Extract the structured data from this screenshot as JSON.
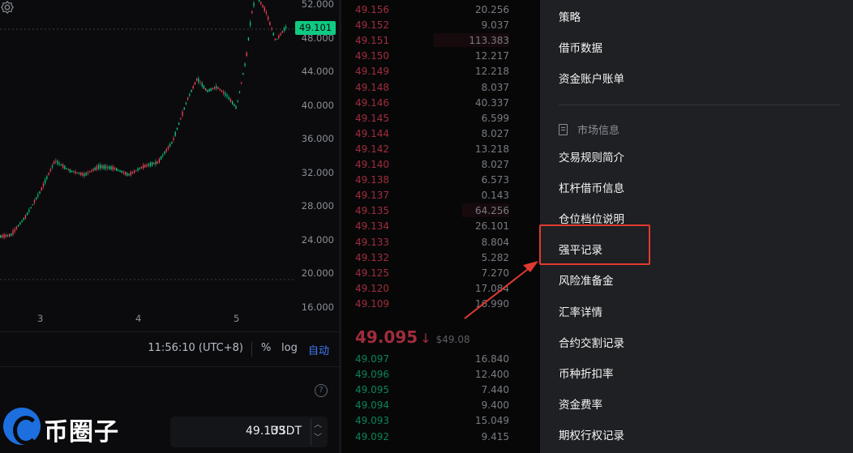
{
  "chart": {
    "y_axis": [
      "52.000",
      "48.000",
      "44.000",
      "40.000",
      "36.000",
      "32.000",
      "28.000",
      "24.000",
      "20.000",
      "16.000"
    ],
    "last_price_tag": "49.101",
    "x_axis": [
      "3",
      "4",
      "5"
    ],
    "colors": {
      "up": "#0ecb81",
      "down": "#f6465d"
    }
  },
  "chart_data": {
    "type": "line",
    "title": "",
    "xlabel": "",
    "ylabel": "",
    "x_ticks": [
      "3",
      "4",
      "5"
    ],
    "ylim": [
      16,
      52
    ],
    "series": [
      {
        "x": [
          2.3,
          2.5,
          2.7,
          2.85,
          3.0,
          3.15,
          3.3,
          3.45,
          3.6,
          3.75,
          3.9,
          4.05,
          4.2,
          4.35,
          4.5,
          4.6,
          4.7,
          4.8,
          4.9,
          5.0,
          5.1,
          5.15,
          5.2,
          5.3,
          5.4,
          5.5
        ],
        "values": [
          23.5,
          24.0,
          24.3,
          26.5,
          29.5,
          33.2,
          32.0,
          31.5,
          32.5,
          32.3,
          31.5,
          32.5,
          33.0,
          35.5,
          40.5,
          43.0,
          41.5,
          42.0,
          41.0,
          39.5,
          45.5,
          50.5,
          53.0,
          51.0,
          47.5,
          49.1
        ]
      }
    ]
  },
  "toolbar": {
    "time": "11:56:10 (UTC+8)",
    "percent": "%",
    "log": "log",
    "auto": "自动"
  },
  "order_form": {
    "price_value": "49.133",
    "price_unit": "USDT",
    "help": "?"
  },
  "watermark": {
    "text": "币圈子"
  },
  "orderbook": {
    "asks": [
      {
        "price": "49.156",
        "qty": "20.256",
        "depth": 0.0
      },
      {
        "price": "49.152",
        "qty": "9.037",
        "depth": 0.0
      },
      {
        "price": "49.151",
        "qty": "113.383",
        "depth": 0.55
      },
      {
        "price": "49.150",
        "qty": "12.217",
        "depth": 0.0
      },
      {
        "price": "49.149",
        "qty": "12.218",
        "depth": 0.0
      },
      {
        "price": "49.148",
        "qty": "8.037",
        "depth": 0.0
      },
      {
        "price": "49.146",
        "qty": "40.337",
        "depth": 0.0
      },
      {
        "price": "49.145",
        "qty": "6.599",
        "depth": 0.0
      },
      {
        "price": "49.144",
        "qty": "8.027",
        "depth": 0.0
      },
      {
        "price": "49.142",
        "qty": "13.218",
        "depth": 0.0
      },
      {
        "price": "49.140",
        "qty": "8.027",
        "depth": 0.0
      },
      {
        "price": "49.138",
        "qty": "6.573",
        "depth": 0.0
      },
      {
        "price": "49.137",
        "qty": "0.143",
        "depth": 0.0
      },
      {
        "price": "49.135",
        "qty": "64.256",
        "depth": 0.34
      },
      {
        "price": "49.134",
        "qty": "26.101",
        "depth": 0.0
      },
      {
        "price": "49.133",
        "qty": "8.804",
        "depth": 0.0
      },
      {
        "price": "49.132",
        "qty": "5.282",
        "depth": 0.0
      },
      {
        "price": "49.125",
        "qty": "7.270",
        "depth": 0.0
      },
      {
        "price": "49.120",
        "qty": "17.084",
        "depth": 0.0
      },
      {
        "price": "49.109",
        "qty": "16.990",
        "depth": 0.0
      }
    ],
    "last": {
      "price": "49.095",
      "arrow": "↓",
      "mark": "$49.08"
    },
    "bids": [
      {
        "price": "49.097",
        "qty": "16.840",
        "depth": 0.0
      },
      {
        "price": "49.096",
        "qty": "12.400",
        "depth": 0.0
      },
      {
        "price": "49.095",
        "qty": "7.440",
        "depth": 0.0
      },
      {
        "price": "49.094",
        "qty": "9.400",
        "depth": 0.0
      },
      {
        "price": "49.093",
        "qty": "15.049",
        "depth": 0.0
      },
      {
        "price": "49.092",
        "qty": "9.415",
        "depth": 0.0
      }
    ]
  },
  "menu": {
    "top_items": [
      "策略",
      "借币数据",
      "资金账户账单"
    ],
    "section_title": "市场信息",
    "section_items": [
      "交易规则简介",
      "杠杆借币信息",
      "仓位档位说明",
      "强平记录",
      "风险准备金",
      "汇率详情",
      "合约交割记录",
      "币种折扣率",
      "资金费率",
      "期权行权记录"
    ],
    "highlighted_item": "强平记录",
    "annotation_color": "#e03a30"
  }
}
